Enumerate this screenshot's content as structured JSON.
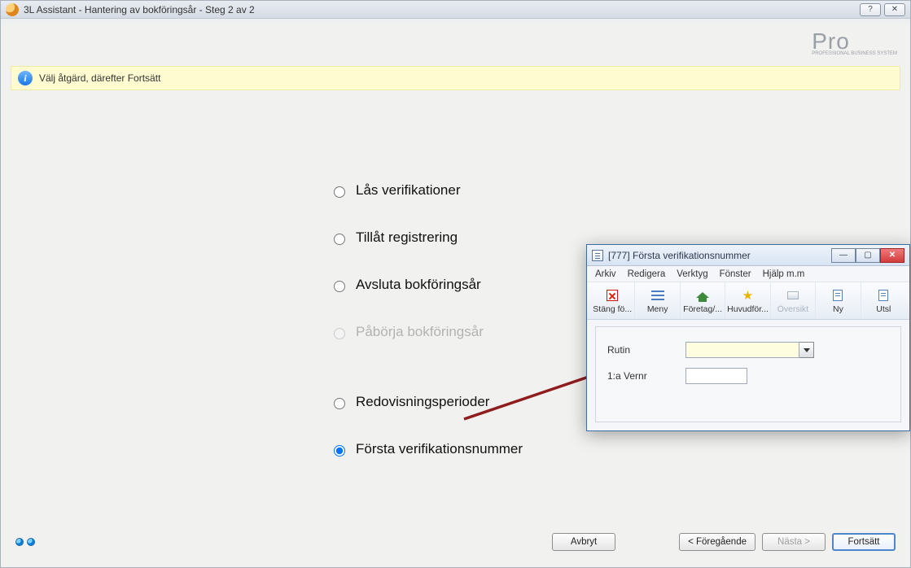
{
  "main": {
    "title": "3L Assistant - Hantering av bokföringsår - Steg 2 av 2",
    "logo": "Pro",
    "logo_sub": "PROFESSIONAL BUSINESS SYSTEM",
    "info_text": "Välj åtgärd, därefter Fortsätt"
  },
  "options": [
    {
      "label": "Lås verifikationer",
      "enabled": true,
      "checked": false
    },
    {
      "label": "Tillåt registrering",
      "enabled": true,
      "checked": false
    },
    {
      "label": "Avsluta bokföringsår",
      "enabled": true,
      "checked": false
    },
    {
      "label": "Påbörja bokföringsår",
      "enabled": false,
      "checked": false
    },
    {
      "label": "Redovisningsperioder",
      "enabled": true,
      "checked": false
    },
    {
      "label": "Första verifikationsnummer",
      "enabled": true,
      "checked": true
    }
  ],
  "footer": {
    "cancel": "Avbryt",
    "prev": "< Föregående",
    "next": "Nästa >",
    "cont": "Fortsätt"
  },
  "child": {
    "title": "[777]  Första verifikationsnummer",
    "menus": [
      "Arkiv",
      "Redigera",
      "Verktyg",
      "Fönster",
      "Hjälp m.m"
    ],
    "toolbar": [
      {
        "label": "Stäng fö...",
        "icon": "close-red",
        "enabled": true
      },
      {
        "label": "Meny",
        "icon": "bars",
        "enabled": true
      },
      {
        "label": "Företag/...",
        "icon": "house",
        "enabled": true
      },
      {
        "label": "Huvudför...",
        "icon": "star",
        "enabled": true
      },
      {
        "label": "Översikt",
        "icon": "box",
        "enabled": false
      },
      {
        "label": "Ny",
        "icon": "doc",
        "enabled": true
      },
      {
        "label": "Utsl",
        "icon": "doc",
        "enabled": true
      }
    ],
    "form": {
      "rutin_label": "Rutin",
      "rutin_value": "",
      "vernr_label": "1:a Vernr",
      "vernr_value": ""
    }
  }
}
